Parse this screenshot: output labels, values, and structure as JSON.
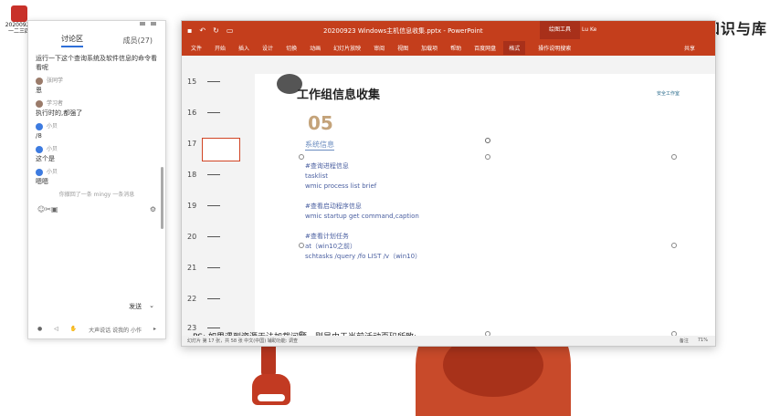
{
  "desktop": {
    "icon_caption": "20200923\n一二三四",
    "watermark": "网络安全的知识与库"
  },
  "discussion": {
    "tab_active": "讨论区",
    "tab_members": "成员(27)",
    "messages": [
      {
        "author": "",
        "text": "运行一下这个查询系统及软件信息的命令看看呢"
      },
      {
        "author": "张同学",
        "text": "恩"
      },
      {
        "author": "学习者",
        "text": "执行时的,都强了"
      },
      {
        "author": "小贝",
        "text": "/8"
      },
      {
        "author": "小贝",
        "text": "这个是"
      },
      {
        "author": "小贝",
        "text": "嗯嗯"
      }
    ],
    "notice": "你撤回了一条 mingy 一条消息",
    "send_label": "发送",
    "bottom_label": "大声说话 说我的 小作"
  },
  "ppt": {
    "title": "20200923 Windows主机信息收集.pptx  -  PowerPoint",
    "context_label": "绘图工具",
    "account": "Lu Ke",
    "ribbon": [
      "文件",
      "开始",
      "插入",
      "设计",
      "切换",
      "动画",
      "幻灯片放映",
      "审阅",
      "视图",
      "加载项",
      "帮助",
      "百度网盘",
      "格式",
      "操作说明搜索"
    ],
    "share_label": "共享",
    "slide_numbers": [
      "15",
      "16",
      "17",
      "18",
      "19",
      "20",
      "21",
      "22",
      "23"
    ],
    "slide": {
      "title": "工作组信息收集",
      "number": "05",
      "subtitle": "系统信息",
      "lines": [
        "#查询进程信息",
        "tasklist",
        "wmic process list brief",
        "",
        "#查看启动程序信息",
        "wmic startup get command,caption",
        "",
        "#查看计划任务",
        "at（win10之前）",
        "schtasks /query /fo LIST /v（win10）"
      ],
      "logo_text": "安全工作室"
    },
    "ps_note": "PS: 如果遇到资源无法加载问题，则是由于当前活动页码所致;",
    "status_left": "幻灯片 第 17 张，共 58 张   中文(中国)   辅助功能: 调查",
    "status_notes": "备注",
    "status_zoom": "71%"
  }
}
